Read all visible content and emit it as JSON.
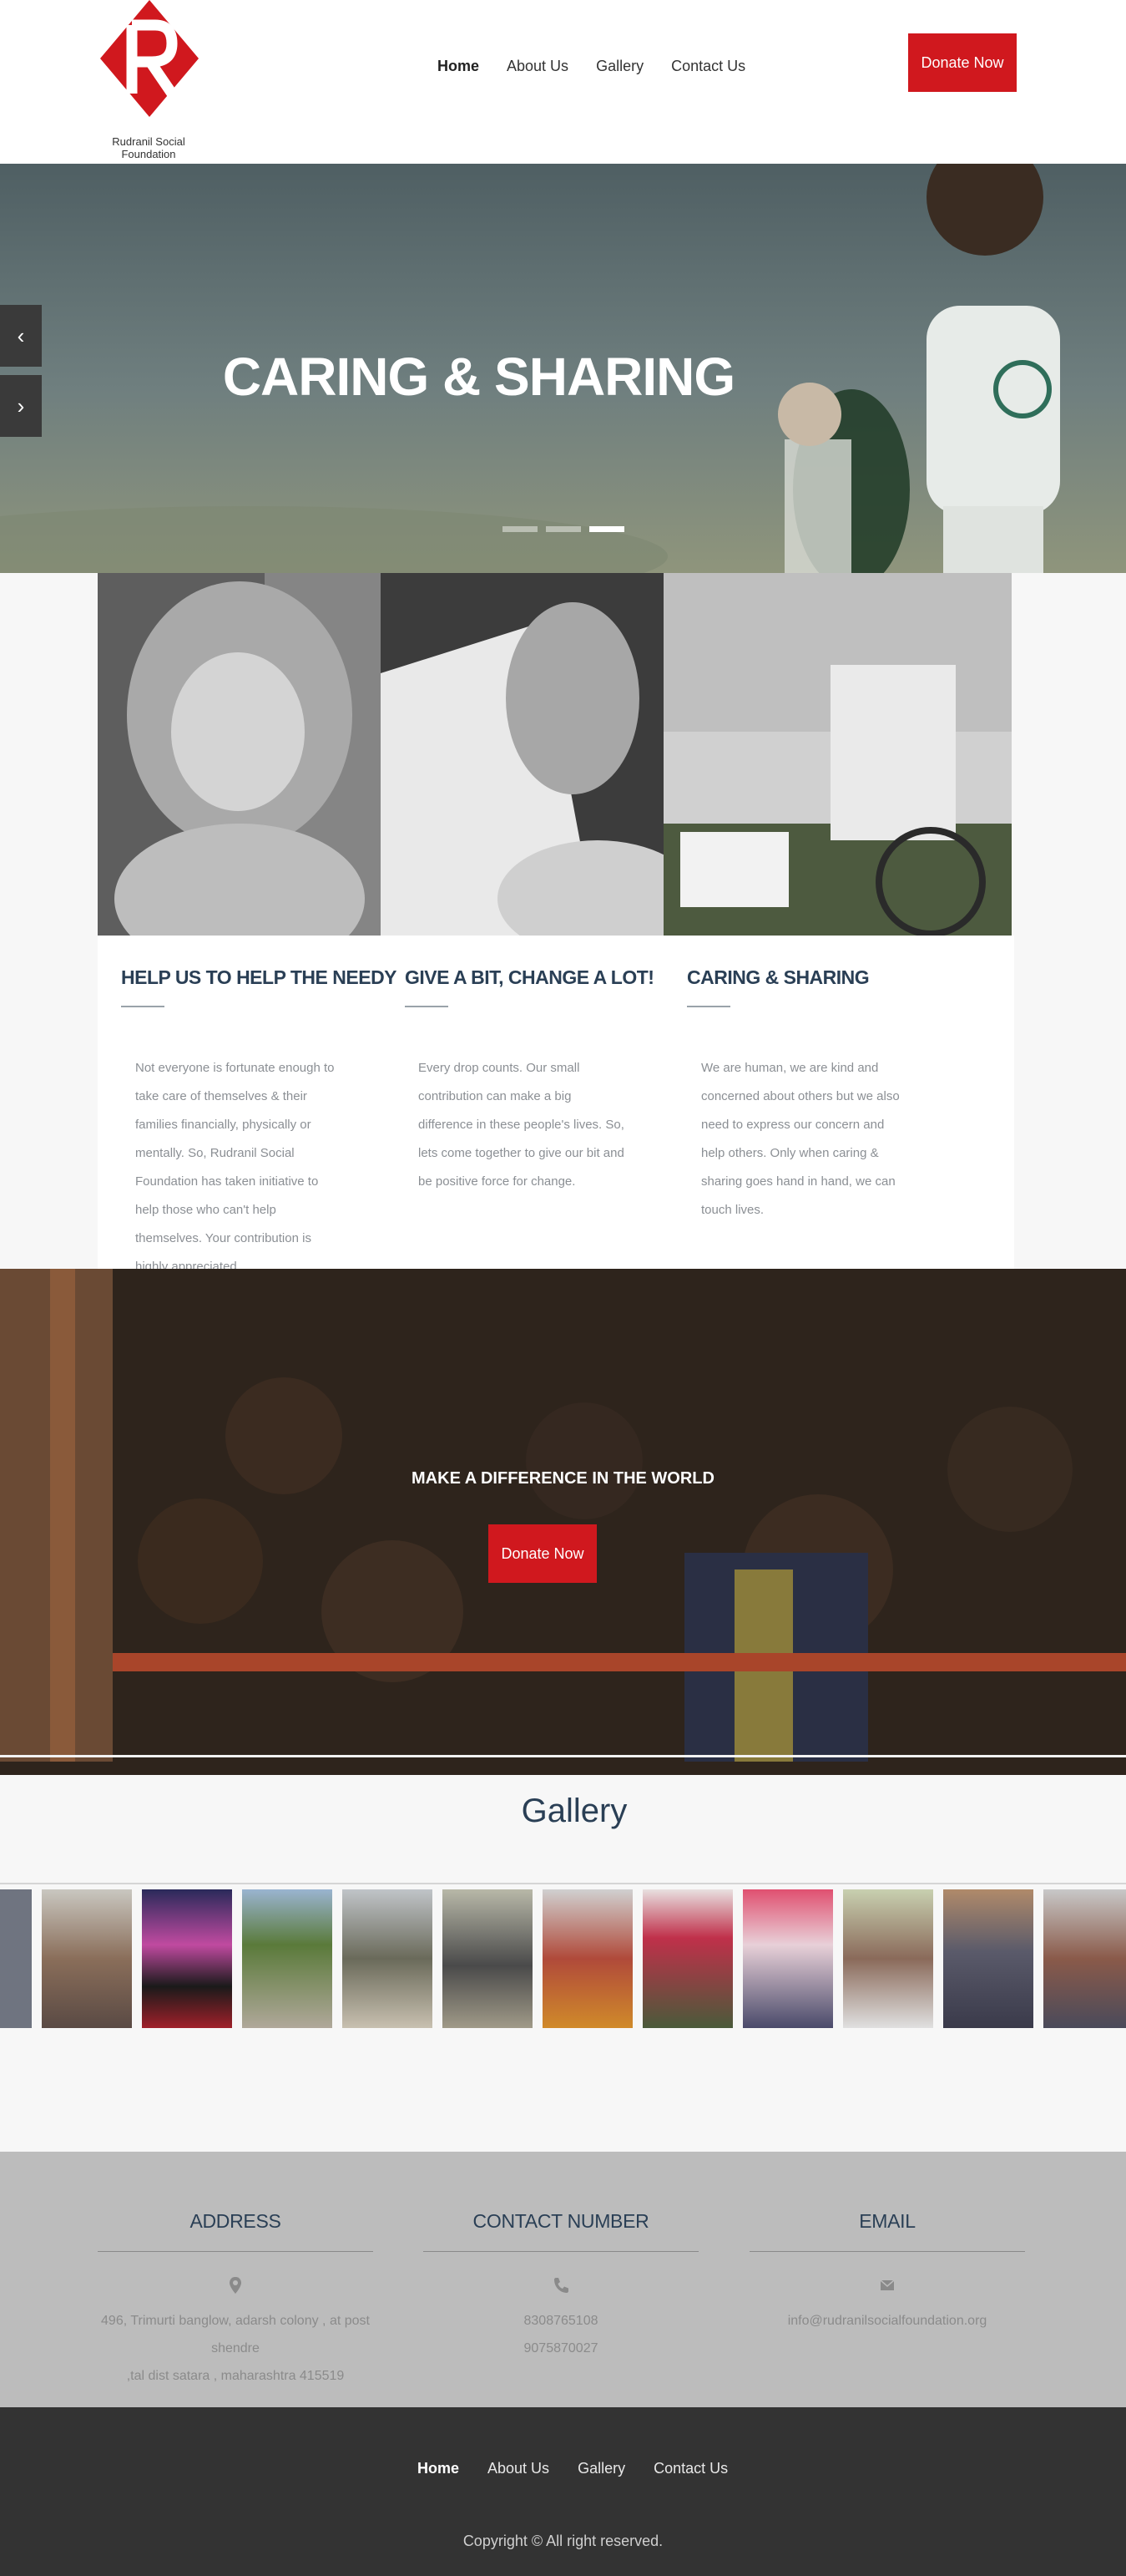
{
  "brand": {
    "name": "Rudranil Social Foundation",
    "logo_letter": "R",
    "accent_color": "#d0181e",
    "heading_color": "#2a3f55"
  },
  "nav": {
    "items": [
      {
        "label": "Home",
        "active": true
      },
      {
        "label": "About Us",
        "active": false
      },
      {
        "label": "Gallery",
        "active": false
      },
      {
        "label": "Contact Us",
        "active": false
      }
    ],
    "donate_label": "Donate Now"
  },
  "hero": {
    "title": "CARING & SHARING",
    "prev_icon": "chevron-left-icon",
    "next_icon": "chevron-right-icon",
    "prev_glyph": "‹",
    "next_glyph": "›",
    "slides_count": 3,
    "active_slide": 3
  },
  "cards": [
    {
      "title": "HELP US TO HELP THE NEEDY",
      "text": "Not everyone is fortunate enough to take care of themselves & their families financially, physically or mentally. So, Rudranil Social Foundation has taken initiative to help those who can't help themselves. Your contribution is highly appreciated."
    },
    {
      "title": "GIVE A BIT, CHANGE A LOT!",
      "text": "Every drop counts. Our small contribution can make a big difference in these people's lives. So, lets come together to give our bit and be positive force for change."
    },
    {
      "title": "CARING & SHARING",
      "text": "We are human, we are kind and concerned about others but we also need to express our concern and help others. Only when caring & sharing goes hand in hand, we can touch lives."
    }
  ],
  "cta": {
    "title": "MAKE A DIFFERENCE IN THE WORLD",
    "button_label": "Donate Now"
  },
  "gallery": {
    "title": "Gallery",
    "thumbnail_count": 12
  },
  "contact": {
    "address": {
      "title": "ADDRESS",
      "icon": "map-marker-icon",
      "lines": [
        "496, Trimurti banglow, adarsh colony , at post shendre",
        ",tal dist satara , maharashtra 415519"
      ]
    },
    "phone": {
      "title": "CONTACT NUMBER",
      "icon": "phone-icon",
      "lines": [
        "8308765108",
        "9075870027"
      ]
    },
    "email": {
      "title": "EMAIL",
      "icon": "envelope-icon",
      "lines": [
        "info@rudranilsocialfoundation.org"
      ]
    }
  },
  "footer": {
    "nav": [
      {
        "label": "Home",
        "active": true
      },
      {
        "label": "About Us",
        "active": false
      },
      {
        "label": "Gallery",
        "active": false
      },
      {
        "label": "Contact Us",
        "active": false
      }
    ],
    "copyright": "Copyright © All right reserved."
  }
}
